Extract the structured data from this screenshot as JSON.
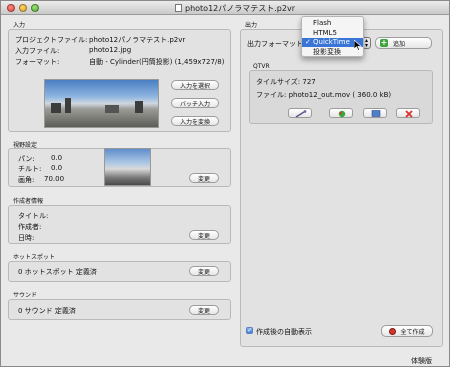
{
  "window": {
    "title": "photo12パノラマテスト.p2vr"
  },
  "input": {
    "section_label": "入力",
    "project_label": "プロジェクトファイル:",
    "project_value": "photo12パノラマテスト.p2vr",
    "file_label": "入力ファイル:",
    "file_value": "photo12.jpg",
    "format_label": "フォーマット:",
    "format_value": "自動 - Cylinder(円筒投影) (1,459x727/8)",
    "select_input_button": "入力を選択",
    "batch_input_button": "バッチ入力",
    "convert_input_button": "入力を変換"
  },
  "view": {
    "section_label": "視野設定",
    "pan_label": "パン:",
    "pan_value": "0.0",
    "tilt_label": "チルト:",
    "tilt_value": "0.0",
    "fov_label": "画角:",
    "fov_value": "70.00",
    "change_button": "変更"
  },
  "author": {
    "section_label": "作成者情報",
    "title_label": "タイトル:",
    "author_label": "作成者:",
    "date_label": "日時:",
    "change_button": "変更"
  },
  "hotspot": {
    "section_label": "ホットスポット",
    "text": "0 ホットスポット 定義済",
    "change_button": "変更"
  },
  "sound": {
    "section_label": "サウンド",
    "text": "0 サウンド 定義済",
    "change_button": "変更"
  },
  "output": {
    "section_label": "出力",
    "format_label": "出力フォーマット",
    "add_button": "追加",
    "menu_options": [
      "Flash",
      "HTML5",
      "QuickTime",
      "投影変換"
    ],
    "menu_selected": "QuickTime",
    "qtvr_panel_title": "QTVR",
    "tile_size_text": "タイルサイズ: 727",
    "file_text": "ファイル: photo12_out.mov (     360.0 kB)",
    "auto_show_label": "作成後の自動表示",
    "auto_show_checked": true,
    "build_all_button": "全て作成"
  },
  "footer": {
    "trial_text": "体験版"
  },
  "icons": {
    "edit": "wrench-icon",
    "open": "open-output-icon",
    "preview": "preview-icon",
    "delete": "delete-icon",
    "add": "plus-icon",
    "build": "build-icon"
  },
  "colors": {
    "menu_selection": "#3875d7",
    "add_green": "#3aa53a",
    "delete_red": "#d9342b"
  }
}
